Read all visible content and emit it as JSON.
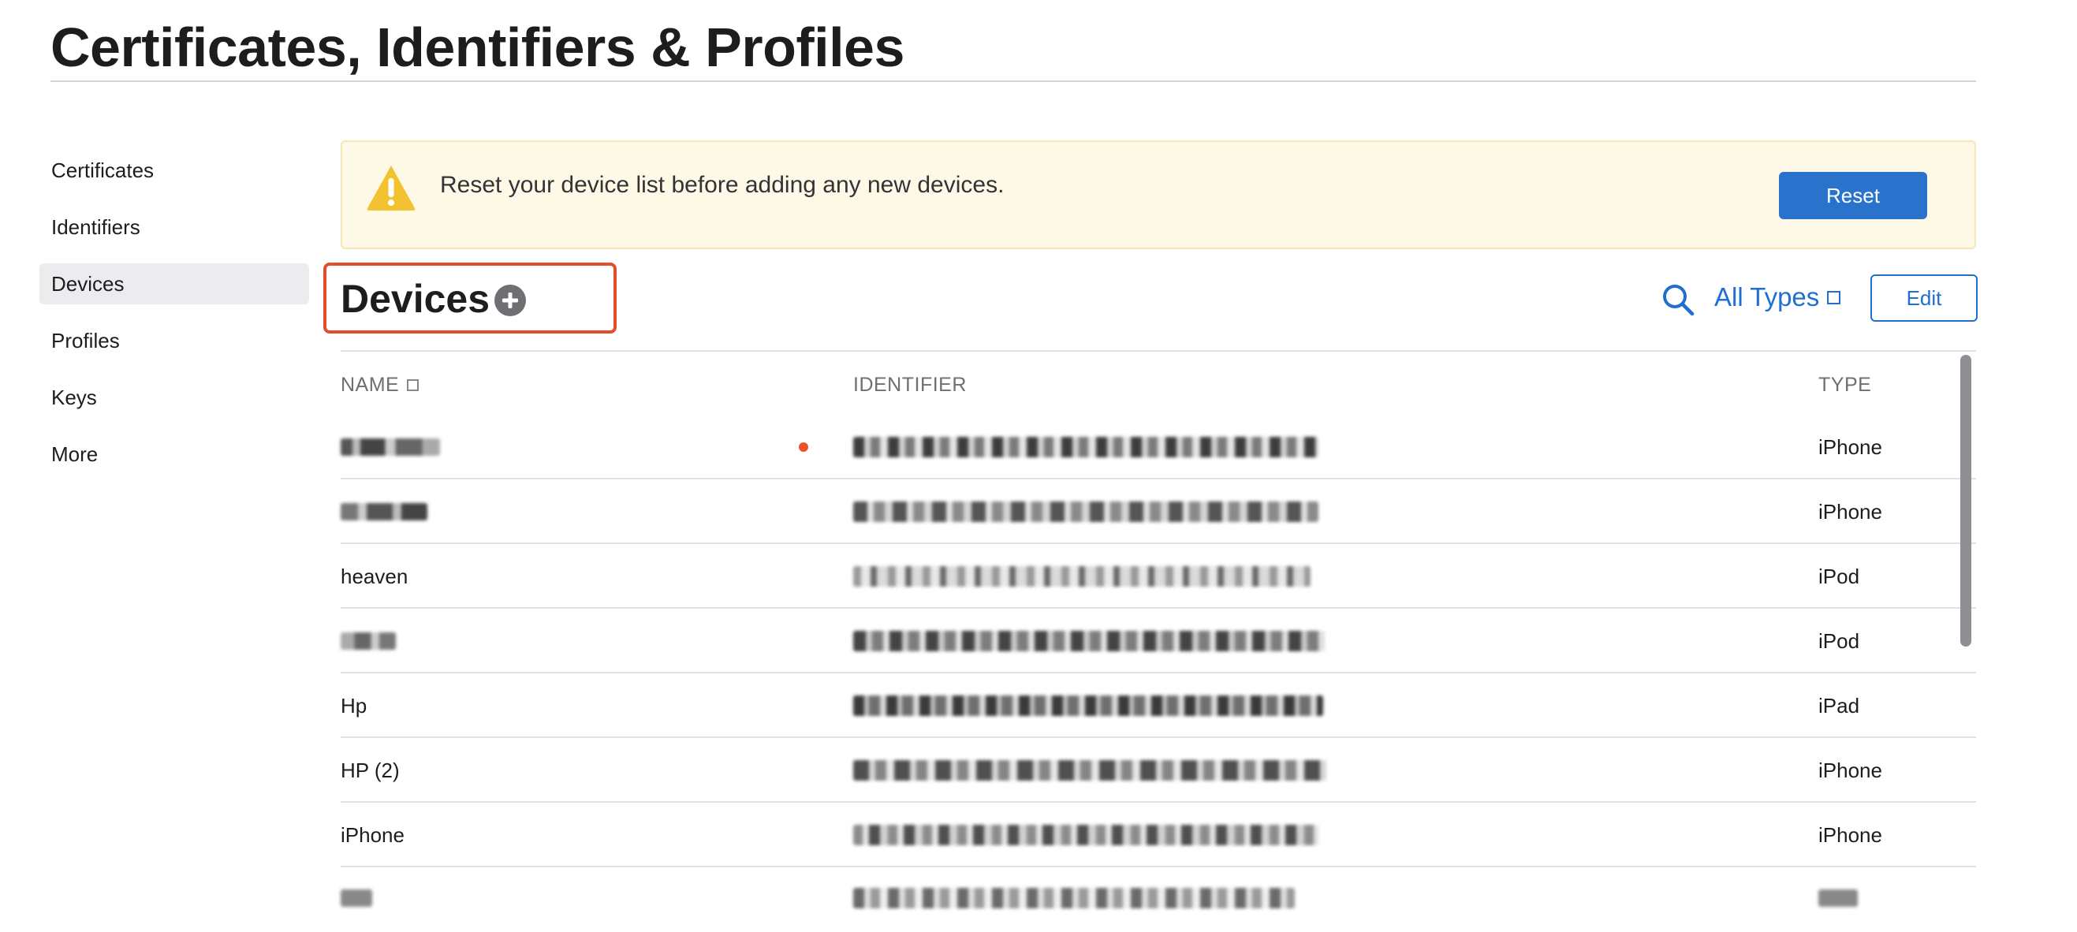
{
  "page": {
    "title": "Certificates, Identifiers & Profiles"
  },
  "sidebar": {
    "items": [
      {
        "label": "Certificates",
        "active": false
      },
      {
        "label": "Identifiers",
        "active": false
      },
      {
        "label": "Devices",
        "active": true
      },
      {
        "label": "Profiles",
        "active": false
      },
      {
        "label": "Keys",
        "active": false
      },
      {
        "label": "More",
        "active": false
      }
    ]
  },
  "banner": {
    "icon": "warning-icon",
    "text": "Reset your device list before adding any new devices.",
    "button_label": "Reset"
  },
  "section": {
    "title": "Devices",
    "add_icon": "plus-circle-icon",
    "search_icon": "search-icon",
    "filter_label": "All Types",
    "edit_label": "Edit"
  },
  "table": {
    "columns": {
      "name": "NAME",
      "identifier": "IDENTIFIER",
      "type": "TYPE"
    },
    "rows": [
      {
        "name": "",
        "identifier": "",
        "type": "iPhone",
        "new_dot": true
      },
      {
        "name": "",
        "identifier": "",
        "type": "iPhone",
        "new_dot": false
      },
      {
        "name": "heaven",
        "identifier": "",
        "type": "iPod",
        "new_dot": false
      },
      {
        "name": "",
        "identifier": "",
        "type": "iPod",
        "new_dot": false
      },
      {
        "name": "Hp",
        "identifier": "",
        "type": "iPad",
        "new_dot": false
      },
      {
        "name": "HP (2)",
        "identifier": "",
        "type": "iPhone",
        "new_dot": false
      },
      {
        "name": "iPhone",
        "identifier": "",
        "type": "iPhone",
        "new_dot": false
      },
      {
        "name": "",
        "identifier": "",
        "type": "",
        "new_dot": false
      }
    ]
  },
  "colors": {
    "accent": "#1f6fd1",
    "reset_button": "#2a73cc",
    "banner_bg": "#fef9e6",
    "highlight": "#e24e2b",
    "new_dot": "#e8532b"
  }
}
